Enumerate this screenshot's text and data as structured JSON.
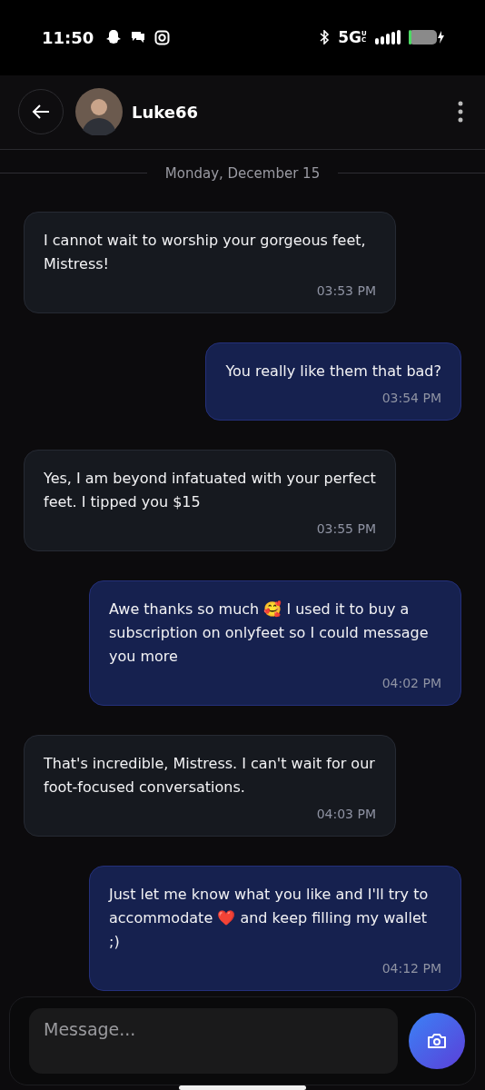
{
  "status_bar": {
    "time": "11:50",
    "network": "5G",
    "network_sub": "UC"
  },
  "header": {
    "name": "Luke66"
  },
  "date_divider": "Monday, December 15",
  "messages": [
    {
      "text": "I cannot wait to worship your gorgeous feet, Mistress!",
      "time": "03:53 PM",
      "outgoing": false
    },
    {
      "text": "You really like them that bad?",
      "time": "03:54 PM",
      "outgoing": true
    },
    {
      "text": "Yes, I am beyond infatuated with your perfect feet. I tipped you $15",
      "time": "03:55 PM",
      "outgoing": false
    },
    {
      "text": "Awe thanks so much 🥰 I used it to buy a subscription on onlyfeet so I could message you more",
      "time": "04:02 PM",
      "outgoing": true
    },
    {
      "text": "That's incredible, Mistress. I can't wait for our foot-focused conversations.",
      "time": "04:03 PM",
      "outgoing": false
    },
    {
      "text": "Just let me know what you like and I'll try to accommodate ❤️ and keep filling my wallet ;)",
      "time": "04:12 PM",
      "outgoing": true
    }
  ],
  "composer": {
    "placeholder": "Message..."
  }
}
